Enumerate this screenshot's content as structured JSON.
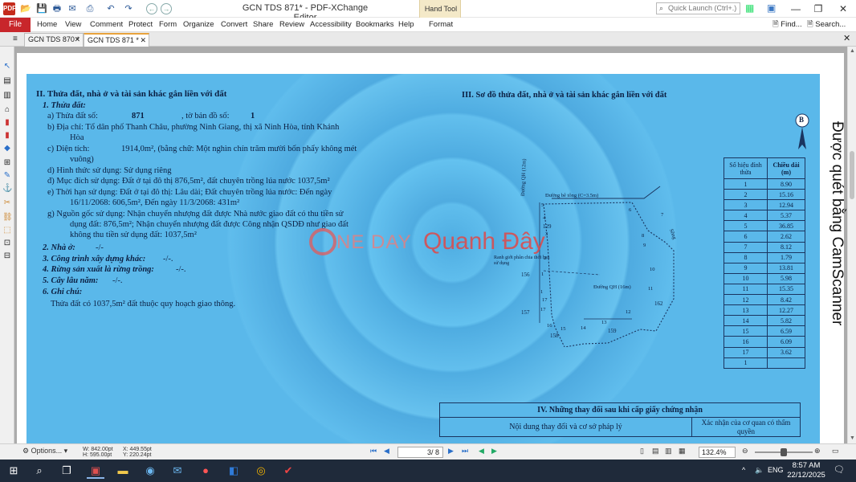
{
  "app": {
    "title": "GCN TDS 871* - PDF-XChange Editor",
    "context_tool": "Hand Tool",
    "context_tab": "Format",
    "quick_launch_placeholder": "Quick Launch (Ctrl+.)",
    "find_label": "Find...",
    "search_label": "Search..."
  },
  "menu": {
    "file": "File",
    "tabs": [
      "Home",
      "View",
      "Comment",
      "Protect",
      "Form",
      "Organize",
      "Convert",
      "Share",
      "Review",
      "Accessibility",
      "Bookmarks",
      "Help"
    ]
  },
  "doc_tabs": [
    {
      "label": "GCN TDS 870 *"
    },
    {
      "label": "GCN TDS 871 *"
    }
  ],
  "page": {
    "left": {
      "heading": "II. Thửa đất, nhà ở và tài sản khác gắn liền với đất",
      "s1": "1. Thửa đất:",
      "a_label": "a) Thửa đất số:",
      "a_value": "871",
      "a_map_label": ", tờ bản đồ số:",
      "a_map_value": "1",
      "b_line1": "b) Địa chỉ:  Tổ dân phố Thanh Châu, phường Ninh Giang, thị xã Ninh Hòa, tỉnh Khánh",
      "b_line2": "Hòa",
      "c_label": "c) Diện tích:",
      "c_value": "1914,0m², (bằng chữ: Một nghìn chín trăm mười bốn phẩy không mét",
      "c_line2": "vuông)",
      "d": "d) Hình thức sử dụng:   Sử dụng riêng",
      "dd": "đ) Mục đích sử dụng:  Đất ở tại đô thị 876,5m², đất chuyên trồng lúa nước 1037,5m²",
      "e_line1": "e) Thời hạn sử dụng:  Đất ở tại đô thị: Lâu dài; Đất chuyên trồng lúa nước: Đến ngày",
      "e_line2": "16/11/2068: 606,5m², Đến ngày 11/3/2068: 431m²",
      "g_line1": "g) Nguồn gốc sử dụng:  Nhận chuyển nhượng đất được Nhà nước giao đất có thu tiền sử",
      "g_line2": "dụng đất: 876,5m²; Nhận chuyển nhượng đất được Công nhận QSDĐ như giao đất",
      "g_line3": "không thu tiền sử dụng đất: 1037,5m²",
      "s2": "2. Nhà ở:",
      "s2v": "-/-",
      "s3": "3. Công trình xây dựng khác:",
      "s3v": "-/-.",
      "s4": "4. Rừng sản xuất là rừng trồng:",
      "s4v": "-/-.",
      "s5": "5. Cây lâu năm:",
      "s5v": "-/-.",
      "s6": "6. Ghi chú:",
      "note": "Thửa đất có 1037,5m² đất thuộc quy hoạch giao thông."
    },
    "right": {
      "heading": "III. Sơ đồ thửa đất, nhà ở và tài sản khác gắn liền với đất",
      "compass": "B",
      "road1": "Đường bê tông (C=3.5m)",
      "road2": "Đường QH (16m)",
      "road3": "Đường QH (12m)",
      "road4": "Sông",
      "boundary_note": "Ranh giới phân chia thời hạn sử dụng",
      "parcels": [
        "129",
        "156",
        "157",
        "158",
        "159",
        "162"
      ],
      "vertices": [
        "1",
        "2",
        "3",
        "4",
        "5",
        "6",
        "7",
        "8",
        "9",
        "10",
        "11",
        "12",
        "13",
        "14",
        "15",
        "16",
        "17",
        "17",
        "1"
      ],
      "table_headers": [
        "Số hiệu đỉnh thửa",
        "Chiều dài (m)"
      ],
      "table_rows": [
        [
          "1",
          "8.90"
        ],
        [
          "2",
          "15.16"
        ],
        [
          "3",
          "12.94"
        ],
        [
          "4",
          "5.37"
        ],
        [
          "5",
          "36.85"
        ],
        [
          "6",
          "2.62"
        ],
        [
          "7",
          "8.12"
        ],
        [
          "8",
          "1.79"
        ],
        [
          "9",
          "13.81"
        ],
        [
          "10",
          "5.98"
        ],
        [
          "11",
          "15.35"
        ],
        [
          "12",
          "8.42"
        ],
        [
          "13",
          "12.27"
        ],
        [
          "14",
          "5.82"
        ],
        [
          "15",
          "6.59"
        ],
        [
          "16",
          "6.09"
        ],
        [
          "17",
          "3.62"
        ],
        [
          "1",
          ""
        ]
      ],
      "changes_heading": "IV. Những thay đổi sau khi cấp giấy chứng nhận",
      "changes_col1": "Nội dung thay đổi và cơ sở pháp lý",
      "changes_col2": "Xác nhận của cơ quan có thẩm quyền"
    },
    "watermark": {
      "brand1": "NE DAY",
      "brand2": "Quanh Đây"
    },
    "scanner": "Được quét bằng CamScanner"
  },
  "status": {
    "options": "Options...",
    "w": "W: 842.00pt",
    "h": "H: 595.00pt",
    "x": "X: 449.55pt",
    "y": "Y: 220.24pt",
    "page_value": "3",
    "page_total": "/ 8",
    "zoom": "132.4%"
  },
  "taskbar": {
    "lang": "ENG",
    "time": "8:57 AM",
    "date": "22/12/2025"
  }
}
